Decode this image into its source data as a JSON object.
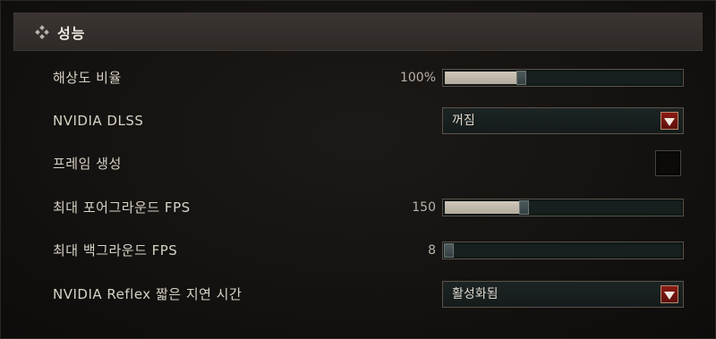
{
  "section": {
    "title": "성능",
    "icon": "diamond-cluster-icon"
  },
  "settings": {
    "resolution_scale": {
      "label": "해상도 비율",
      "value_text": "100%",
      "fraction": 0.32
    },
    "dlss": {
      "label": "NVIDIA DLSS",
      "value": "꺼짐"
    },
    "frame_generation": {
      "label": "프레임 생성",
      "checked": false
    },
    "max_fg_fps": {
      "label": "최대 포어그라운드 FPS",
      "value_text": "150",
      "fraction": 0.33
    },
    "max_bg_fps": {
      "label": "최대 백그라운드 FPS",
      "value_text": "8",
      "fraction": 0.0
    },
    "reflex": {
      "label": "NVIDIA Reflex 짧은 지연 시간",
      "value": "활성화됨"
    }
  },
  "colors": {
    "accent_red": "#7a1510",
    "slider_fill": "#c4bcae"
  }
}
